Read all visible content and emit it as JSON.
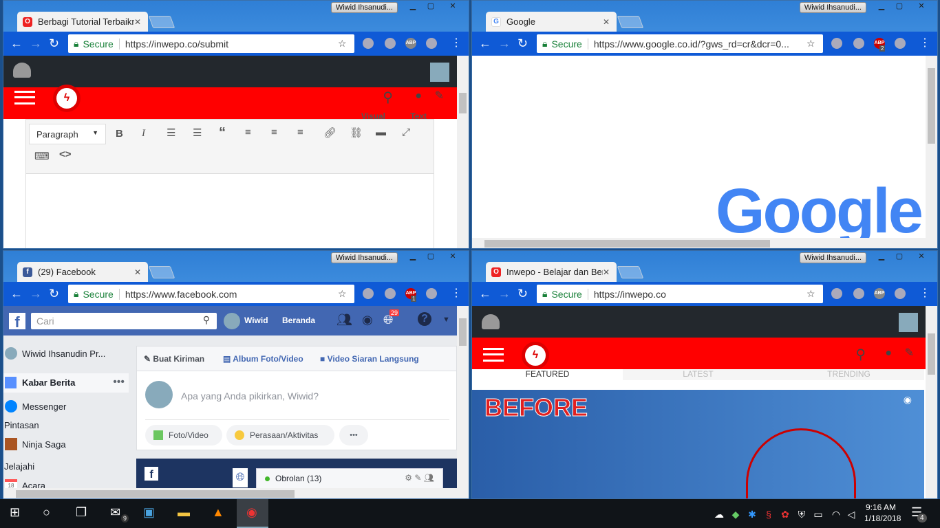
{
  "windows": {
    "tl": {
      "tab_title": "Berbagi Tutorial Terbaikn",
      "user": "Wiwid Ihsanudi...",
      "secure": "Secure",
      "url": "https://inwepo.co/submit",
      "editor": {
        "tab_visual": "Visual",
        "tab_text": "Text",
        "format": "Paragraph"
      }
    },
    "tr": {
      "tab_title": "Google",
      "user": "Wiwid Ihsanudi...",
      "secure": "Secure",
      "url": "https://www.google.co.id/?gws_rd=cr&dcr=0...",
      "logo": "Google",
      "abp_badge": "2"
    },
    "bl": {
      "tab_title": "(29) Facebook",
      "user": "Wiwid Ihsanudi...",
      "secure": "Secure",
      "url": "https://www.facebook.com",
      "abp_badge": "1",
      "fb": {
        "search_placeholder": "Cari",
        "user": "Wiwid",
        "home": "Beranda",
        "notif_count": "29",
        "sidebar": {
          "profile": "Wiwid Ihsanudin Pr...",
          "news": "Kabar Berita",
          "messenger": "Messenger",
          "shortcuts": "Pintasan",
          "ninja": "Ninja Saga",
          "explore": "Jelajahi",
          "events": "Acara",
          "events_day": "18"
        },
        "composer": {
          "create": "Buat Kiriman",
          "album": "Album Foto/Video",
          "live": "Video Siaran Langsung",
          "placeholder": "Apa yang Anda pikirkan, Wiwid?",
          "photo": "Foto/Video",
          "feeling": "Perasaan/Aktivitas",
          "more": "•••"
        },
        "chat": "Obrolan (13)"
      }
    },
    "br": {
      "tab_title": "Inwepo - Belajar dan Ber",
      "user": "Wiwid Ihsanudi...",
      "secure": "Secure",
      "url": "https://inwepo.co",
      "tabs": [
        "FEATURED",
        "LATEST",
        "TRENDING"
      ],
      "banner": "BEFORE"
    }
  },
  "taskbar": {
    "mail_badge": "9",
    "time": "9:16 AM",
    "date": "1/18/2018",
    "notif_count": "4"
  }
}
